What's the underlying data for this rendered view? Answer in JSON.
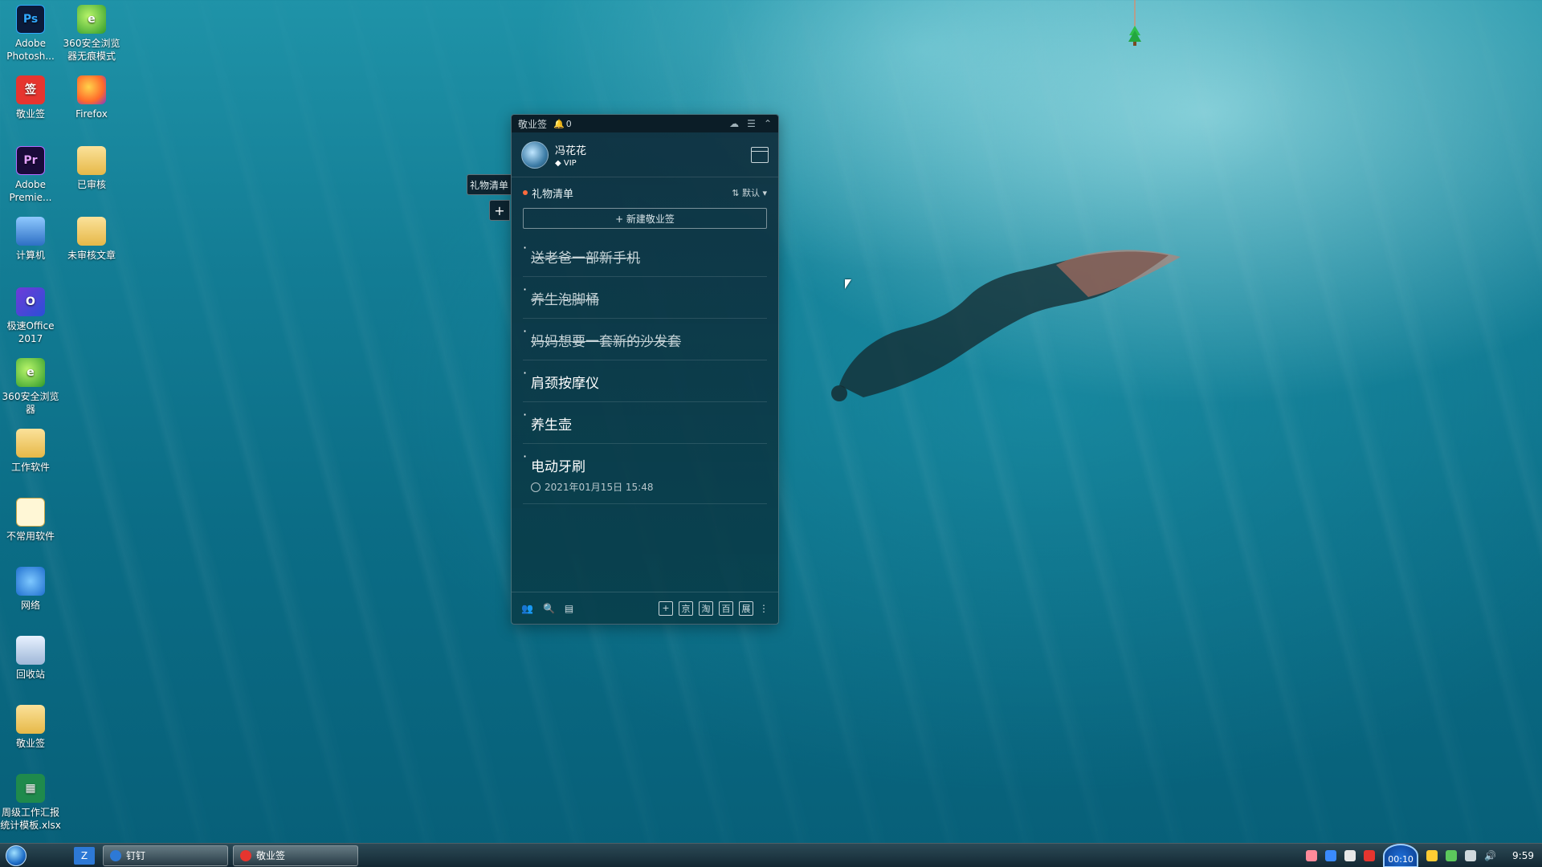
{
  "desktop": {
    "icons": [
      {
        "label": "Adobe Photosh...",
        "icon": "photoshop-icon"
      },
      {
        "label": "360安全浏览器无痕模式",
        "icon": "360-browser-icon"
      },
      {
        "label": "敬业签",
        "icon": "jingyeqian-icon"
      },
      {
        "label": "Firefox",
        "icon": "firefox-icon"
      },
      {
        "label": "Adobe Premie...",
        "icon": "premiere-icon"
      },
      {
        "label": "已审核",
        "icon": "folder-icon"
      },
      {
        "label": "计算机",
        "icon": "computer-icon"
      },
      {
        "label": "未审核文章",
        "icon": "folder-icon"
      },
      {
        "label": "极速Office 2017",
        "icon": "office-icon"
      },
      {
        "label": "360安全浏览器",
        "icon": "360-browser-icon"
      },
      {
        "label": "工作软件",
        "icon": "folder-icon"
      },
      {
        "label": "不常用软件",
        "icon": "folder-icon"
      },
      {
        "label": "网络",
        "icon": "network-icon"
      },
      {
        "label": "回收站",
        "icon": "recycle-bin-icon"
      },
      {
        "label": "敬业签",
        "icon": "folder-icon"
      },
      {
        "label": "周级工作汇报统计模板.xlsx",
        "icon": "excel-icon"
      }
    ]
  },
  "widget": {
    "title": "敬业签",
    "bell_count": "0",
    "user": {
      "name": "冯花花",
      "badge": "VIP"
    },
    "list": {
      "title": "礼物清单",
      "sort_label": "默认"
    },
    "new_button": "+ 新建敬业签",
    "side_tab": "礼物清单",
    "side_plus": "+",
    "items": [
      {
        "text": "送老爸一部新手机",
        "done": true
      },
      {
        "text": "养生泡脚桶",
        "done": true
      },
      {
        "text": "妈妈想要一套新的沙发套",
        "done": true
      },
      {
        "text": "肩颈按摩仪",
        "done": false
      },
      {
        "text": "养生壶",
        "done": false
      },
      {
        "text": "电动牙刷",
        "done": false,
        "time": "2021年01月15日 15:48"
      }
    ],
    "bottom_right": [
      "+",
      "京",
      "淘",
      "百",
      "展"
    ]
  },
  "taskbar": {
    "buttons": [
      {
        "label": "钉钉",
        "color": "#2d79d6"
      },
      {
        "label": "敬业签",
        "color": "#e6352f"
      }
    ],
    "timer": "00:10",
    "clock": "9:59"
  },
  "colors": {
    "accent": "#ff6b3d",
    "widget_bg": "#0b2f3c"
  }
}
